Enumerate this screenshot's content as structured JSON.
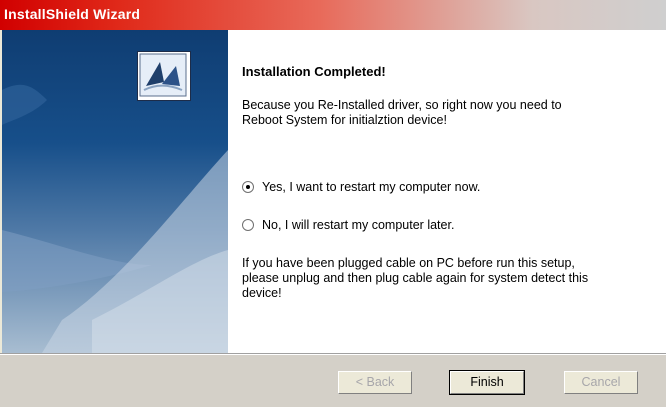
{
  "window": {
    "title": "InstallShield Wizard"
  },
  "sidebar": {
    "icon": "installshield-wizard-icon"
  },
  "content": {
    "heading": "Installation Completed!",
    "paragraph1": "Because you Re-Installed driver, so right now you need to\nReboot System for initialztion device!",
    "options": [
      {
        "label": "Yes, I want to restart my computer now.",
        "selected": true
      },
      {
        "label": "No, I will restart my computer later.",
        "selected": false
      }
    ],
    "paragraph2": "If you have been plugged cable on PC before run this setup,\nplease unplug and then plug cable again for system detect this\ndevice!"
  },
  "footer": {
    "back_label": "< Back",
    "finish_label": "Finish",
    "cancel_label": "Cancel"
  },
  "colors": {
    "titlebar_start": "#d10000",
    "sidebar_top": "#0f3d72",
    "dialog_bg": "#d4d0c8"
  }
}
